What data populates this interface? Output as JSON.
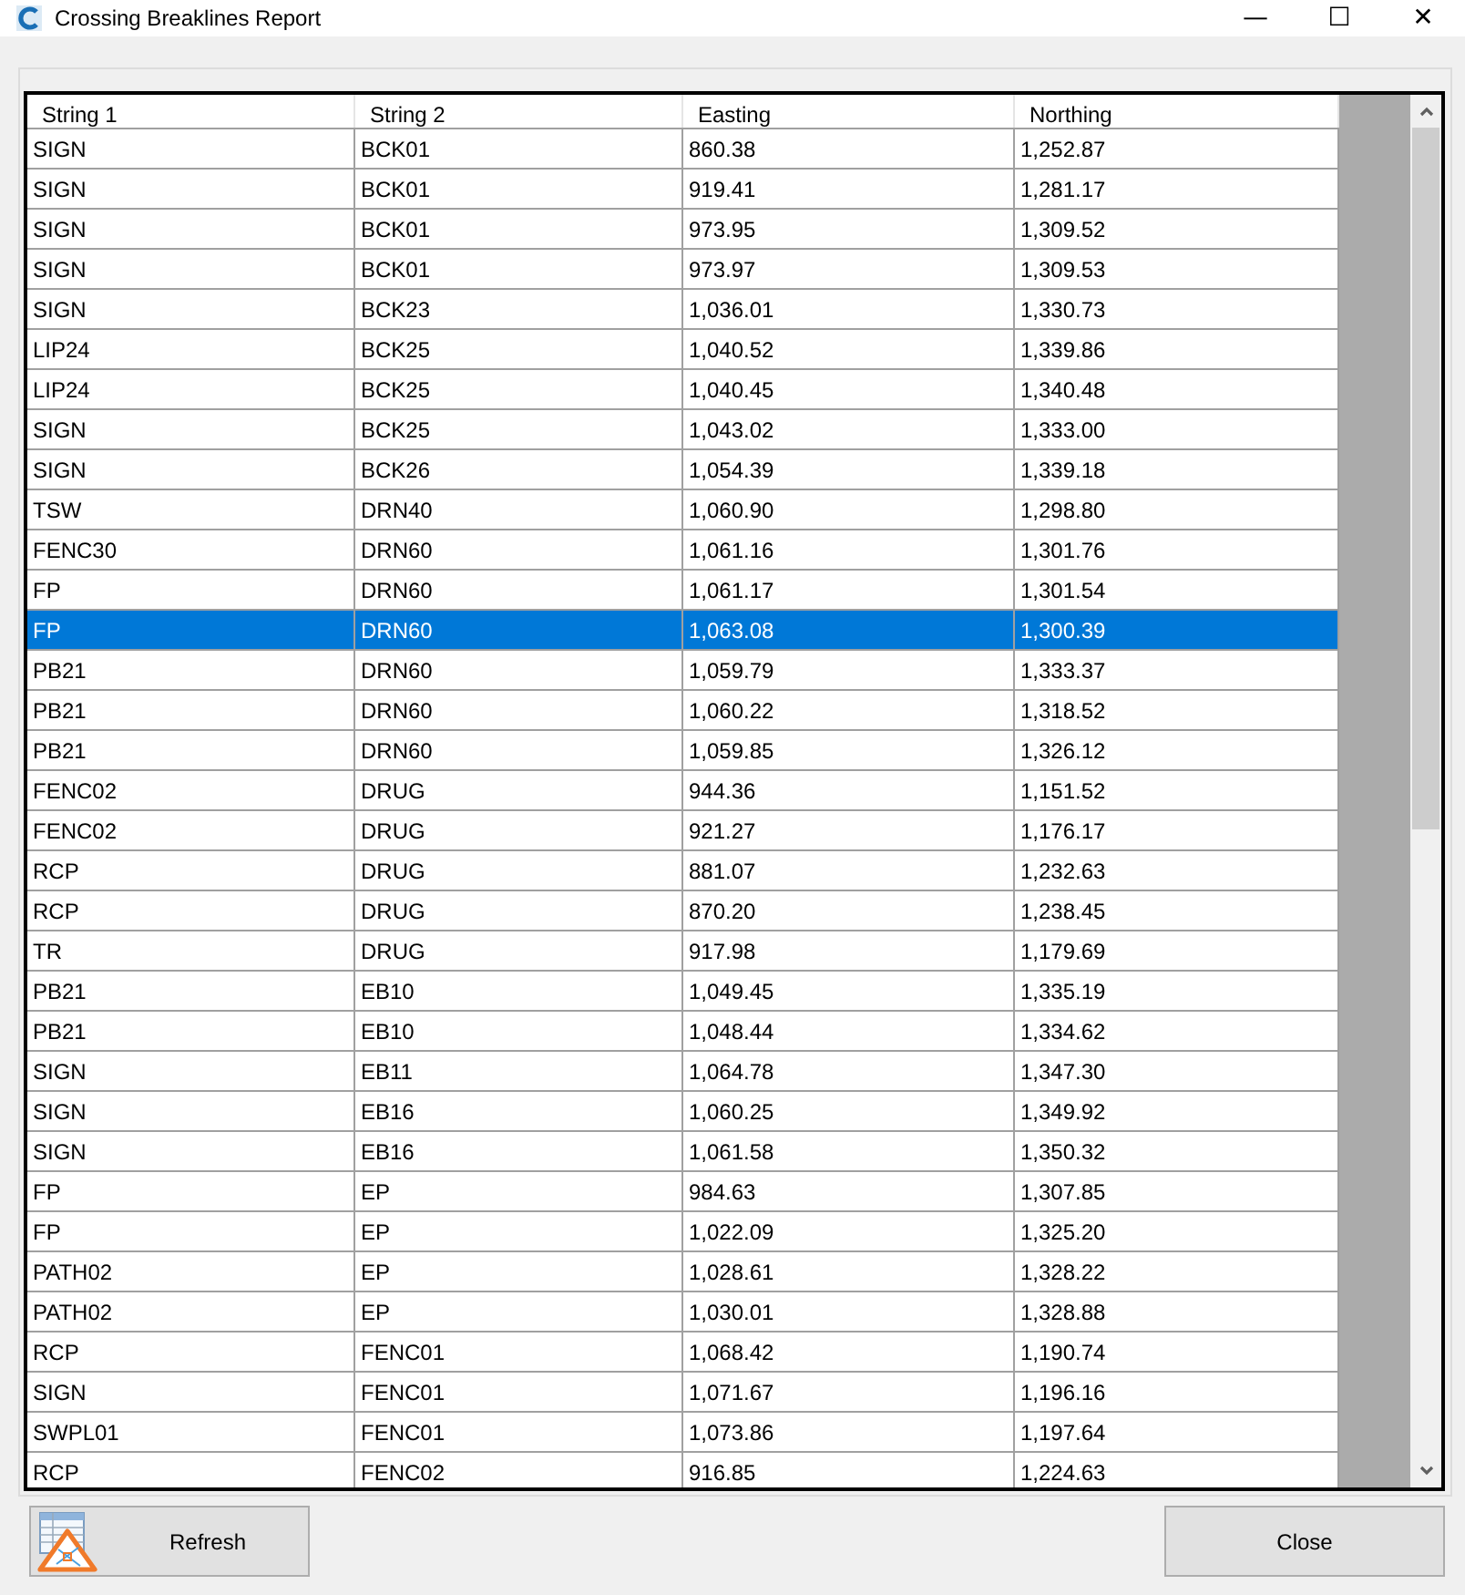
{
  "window": {
    "title": "Crossing Breaklines Report",
    "controls": [
      "—",
      "☐",
      "✕"
    ]
  },
  "table": {
    "columns": [
      "String 1",
      "String 2",
      "Easting",
      "Northing"
    ],
    "rows": [
      {
        "cells": [
          "SIGN",
          "BCK01",
          "860.38",
          "1,252.87"
        ],
        "selected": false
      },
      {
        "cells": [
          "SIGN",
          "BCK01",
          "919.41",
          "1,281.17"
        ],
        "selected": false
      },
      {
        "cells": [
          "SIGN",
          "BCK01",
          "973.95",
          "1,309.52"
        ],
        "selected": false
      },
      {
        "cells": [
          "SIGN",
          "BCK01",
          "973.97",
          "1,309.53"
        ],
        "selected": false
      },
      {
        "cells": [
          "SIGN",
          "BCK23",
          "1,036.01",
          "1,330.73"
        ],
        "selected": false
      },
      {
        "cells": [
          "LIP24",
          "BCK25",
          "1,040.52",
          "1,339.86"
        ],
        "selected": false
      },
      {
        "cells": [
          "LIP24",
          "BCK25",
          "1,040.45",
          "1,340.48"
        ],
        "selected": false
      },
      {
        "cells": [
          "SIGN",
          "BCK25",
          "1,043.02",
          "1,333.00"
        ],
        "selected": false
      },
      {
        "cells": [
          "SIGN",
          "BCK26",
          "1,054.39",
          "1,339.18"
        ],
        "selected": false
      },
      {
        "cells": [
          "TSW",
          "DRN40",
          "1,060.90",
          "1,298.80"
        ],
        "selected": false
      },
      {
        "cells": [
          "FENC30",
          "DRN60",
          "1,061.16",
          "1,301.76"
        ],
        "selected": false
      },
      {
        "cells": [
          "FP",
          "DRN60",
          "1,061.17",
          "1,301.54"
        ],
        "selected": false
      },
      {
        "cells": [
          "FP",
          "DRN60",
          "1,063.08",
          "1,300.39"
        ],
        "selected": true
      },
      {
        "cells": [
          "PB21",
          "DRN60",
          "1,059.79",
          "1,333.37"
        ],
        "selected": false
      },
      {
        "cells": [
          "PB21",
          "DRN60",
          "1,060.22",
          "1,318.52"
        ],
        "selected": false
      },
      {
        "cells": [
          "PB21",
          "DRN60",
          "1,059.85",
          "1,326.12"
        ],
        "selected": false
      },
      {
        "cells": [
          "FENC02",
          "DRUG",
          "944.36",
          "1,151.52"
        ],
        "selected": false
      },
      {
        "cells": [
          "FENC02",
          "DRUG",
          "921.27",
          "1,176.17"
        ],
        "selected": false
      },
      {
        "cells": [
          "RCP",
          "DRUG",
          "881.07",
          "1,232.63"
        ],
        "selected": false
      },
      {
        "cells": [
          "RCP",
          "DRUG",
          "870.20",
          "1,238.45"
        ],
        "selected": false
      },
      {
        "cells": [
          "TR",
          "DRUG",
          "917.98",
          "1,179.69"
        ],
        "selected": false
      },
      {
        "cells": [
          "PB21",
          "EB10",
          "1,049.45",
          "1,335.19"
        ],
        "selected": false
      },
      {
        "cells": [
          "PB21",
          "EB10",
          "1,048.44",
          "1,334.62"
        ],
        "selected": false
      },
      {
        "cells": [
          "SIGN",
          "EB11",
          "1,064.78",
          "1,347.30"
        ],
        "selected": false
      },
      {
        "cells": [
          "SIGN",
          "EB16",
          "1,060.25",
          "1,349.92"
        ],
        "selected": false
      },
      {
        "cells": [
          "SIGN",
          "EB16",
          "1,061.58",
          "1,350.32"
        ],
        "selected": false
      },
      {
        "cells": [
          "FP",
          "EP",
          "984.63",
          "1,307.85"
        ],
        "selected": false
      },
      {
        "cells": [
          "FP",
          "EP",
          "1,022.09",
          "1,325.20"
        ],
        "selected": false
      },
      {
        "cells": [
          "PATH02",
          "EP",
          "1,028.61",
          "1,328.22"
        ],
        "selected": false
      },
      {
        "cells": [
          "PATH02",
          "EP",
          "1,030.01",
          "1,328.88"
        ],
        "selected": false
      },
      {
        "cells": [
          "RCP",
          "FENC01",
          "1,068.42",
          "1,190.74"
        ],
        "selected": false
      },
      {
        "cells": [
          "SIGN",
          "FENC01",
          "1,071.67",
          "1,196.16"
        ],
        "selected": false
      },
      {
        "cells": [
          "SWPL01",
          "FENC01",
          "1,073.86",
          "1,197.64"
        ],
        "selected": false
      },
      {
        "cells": [
          "RCP",
          "FENC02",
          "916.85",
          "1,224.63"
        ],
        "selected": false
      }
    ]
  },
  "buttons": {
    "refresh": "Refresh",
    "close": "Close"
  }
}
